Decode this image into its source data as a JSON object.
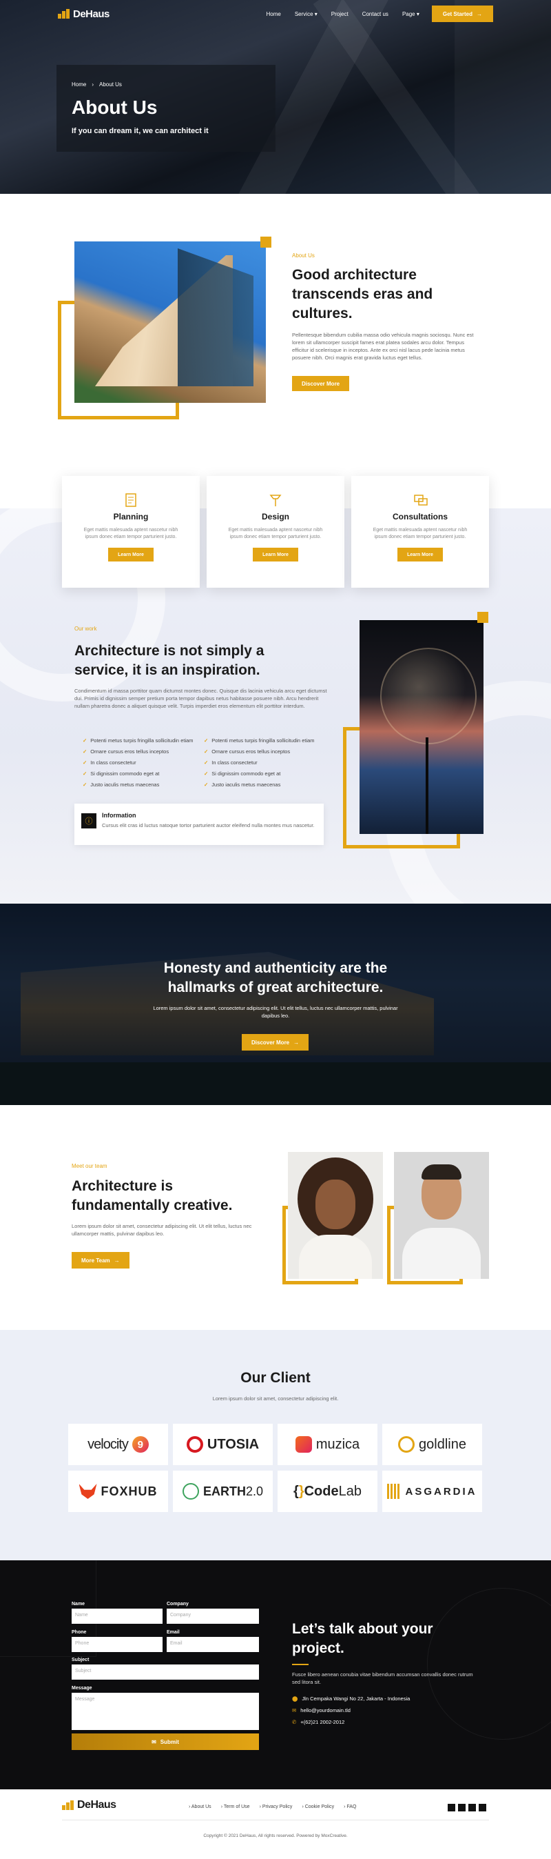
{
  "brand": {
    "name": "DeHaus",
    "accent": "#e3a514"
  },
  "nav": {
    "items": [
      "Home",
      "Service",
      "Project",
      "Contact us",
      "Page"
    ],
    "cta": "Get Started"
  },
  "hero": {
    "crumb_home": "Home",
    "crumb_current": "About Us",
    "title": "About Us",
    "subtitle": "If you can dream it, we can architect it"
  },
  "about": {
    "eyebrow": "About Us",
    "title": "Good architecture transcends eras and cultures.",
    "body": "Pellentesque bibendum cubilia massa odio vehicula magnis sociosqu. Nunc est lorem sit ullamcorper suscipit fames erat platea sodales arcu dolor. Tempus efficitur id scelerisque in inceptos. Ante ex orci nisl lacus pede lacinia metus posuere nibh. Orci magnis erat gravida luctus eget tellus.",
    "button": "Discover More"
  },
  "services": [
    {
      "title": "Planning",
      "body": "Eget mattis malesuada aptent nascetur nibh ipsum donec etiam tempor parturient justo.",
      "button": "Learn More",
      "icon": "document-icon"
    },
    {
      "title": "Design",
      "body": "Eget mattis malesuada aptent nascetur nibh ipsum donec etiam tempor parturient justo.",
      "button": "Learn More",
      "icon": "drafting-icon"
    },
    {
      "title": "Consultations",
      "body": "Eget mattis malesuada aptent nascetur nibh ipsum donec etiam tempor parturient justo.",
      "button": "Learn More",
      "icon": "chat-icon"
    }
  ],
  "work": {
    "eyebrow": "Our work",
    "title": "Architecture is not simply a service, it is an inspiration.",
    "body": "Condimentum id massa porttitor quam dictumst montes donec. Quisque dis lacinia vehicula arcu eget dictumst dui. Primis id dignissim semper pretium porta tempor dapibus netus habitasse posuere nibh. Arcu hendrerit nullam pharetra donec a aliquet quisque velit. Turpis imperdiet eros elementum elit porttitor interdum.",
    "checks": [
      "Potenti metus turpis fringilla sollicitudin etiam",
      "Potenti metus turpis fringilla sollicitudin etiam",
      "Ornare cursus eros tellus inceptos",
      "Ornare cursus eros tellus inceptos",
      "In class consectetur",
      "In class consectetur",
      "Si dignissim commodo eget at",
      "Si dignissim commodo eget at",
      "Justo iaculis metus maecenas",
      "Justo iaculis metus maecenas"
    ],
    "info_title": "Information",
    "info_body": "Cursus elit cras id luctus natoque tortor parturient auctor eleifend nulla montes mus nascetur."
  },
  "quote": {
    "title": "Honesty and authenticity are the hallmarks of great architecture.",
    "body": "Lorem ipsum dolor sit amet, consectetur adipiscing elit. Ut elit tellus, luctus nec ullamcorper mattis, pulvinar dapibus leo.",
    "button": "Discover More"
  },
  "team": {
    "eyebrow": "Meet our team",
    "title": "Architecture is fundamentally creative.",
    "body": "Lorem ipsum dolor sit amet, consectetur adipiscing elit. Ut elit tellus, luctus nec ullamcorper mattis, pulvinar dapibus leo.",
    "button": "More Team"
  },
  "clients": {
    "title": "Our Client",
    "subtitle": "Lorem ipsum dolor sit amet, consectetur adipiscing elit.",
    "logos": [
      "velocity",
      "UTOSIA",
      "muzica",
      "goldline",
      "FOXHUB",
      "EARTH2.0",
      "{CodeLab}",
      "ASGARDIA"
    ],
    "velocity_num": "9",
    "earth_main": "EARTH",
    "earth_suffix": "2.0",
    "codelab_code": "Code",
    "codelab_lab": "Lab"
  },
  "contact": {
    "labels": {
      "name": "Name",
      "company": "Company",
      "phone": "Phone",
      "email": "Email",
      "subject": "Subject",
      "message": "Message"
    },
    "placeholders": {
      "name": "Name",
      "company": "Company",
      "phone": "Phone",
      "email": "Email",
      "subject": "Subject",
      "message": "Message"
    },
    "submit": "Submit",
    "title": "Let’s talk about your project.",
    "body": "Fusce libero aenean conubia vitae bibendum accumsan convallis donec rutrum sed litora sit.",
    "address": "Jln Cempaka Wangi No 22, Jakarta - Indonesia",
    "email": "hello@yourdomain.tld",
    "phone": "+(62)21 2002-2012"
  },
  "footer": {
    "links": [
      "About Us",
      "Term of Use",
      "Privacy Policy",
      "Cookie Policy",
      "FAQ"
    ],
    "copyright": "Copyright © 2021 DeHaus, All rights reserved. Powered by MoxCreative."
  }
}
